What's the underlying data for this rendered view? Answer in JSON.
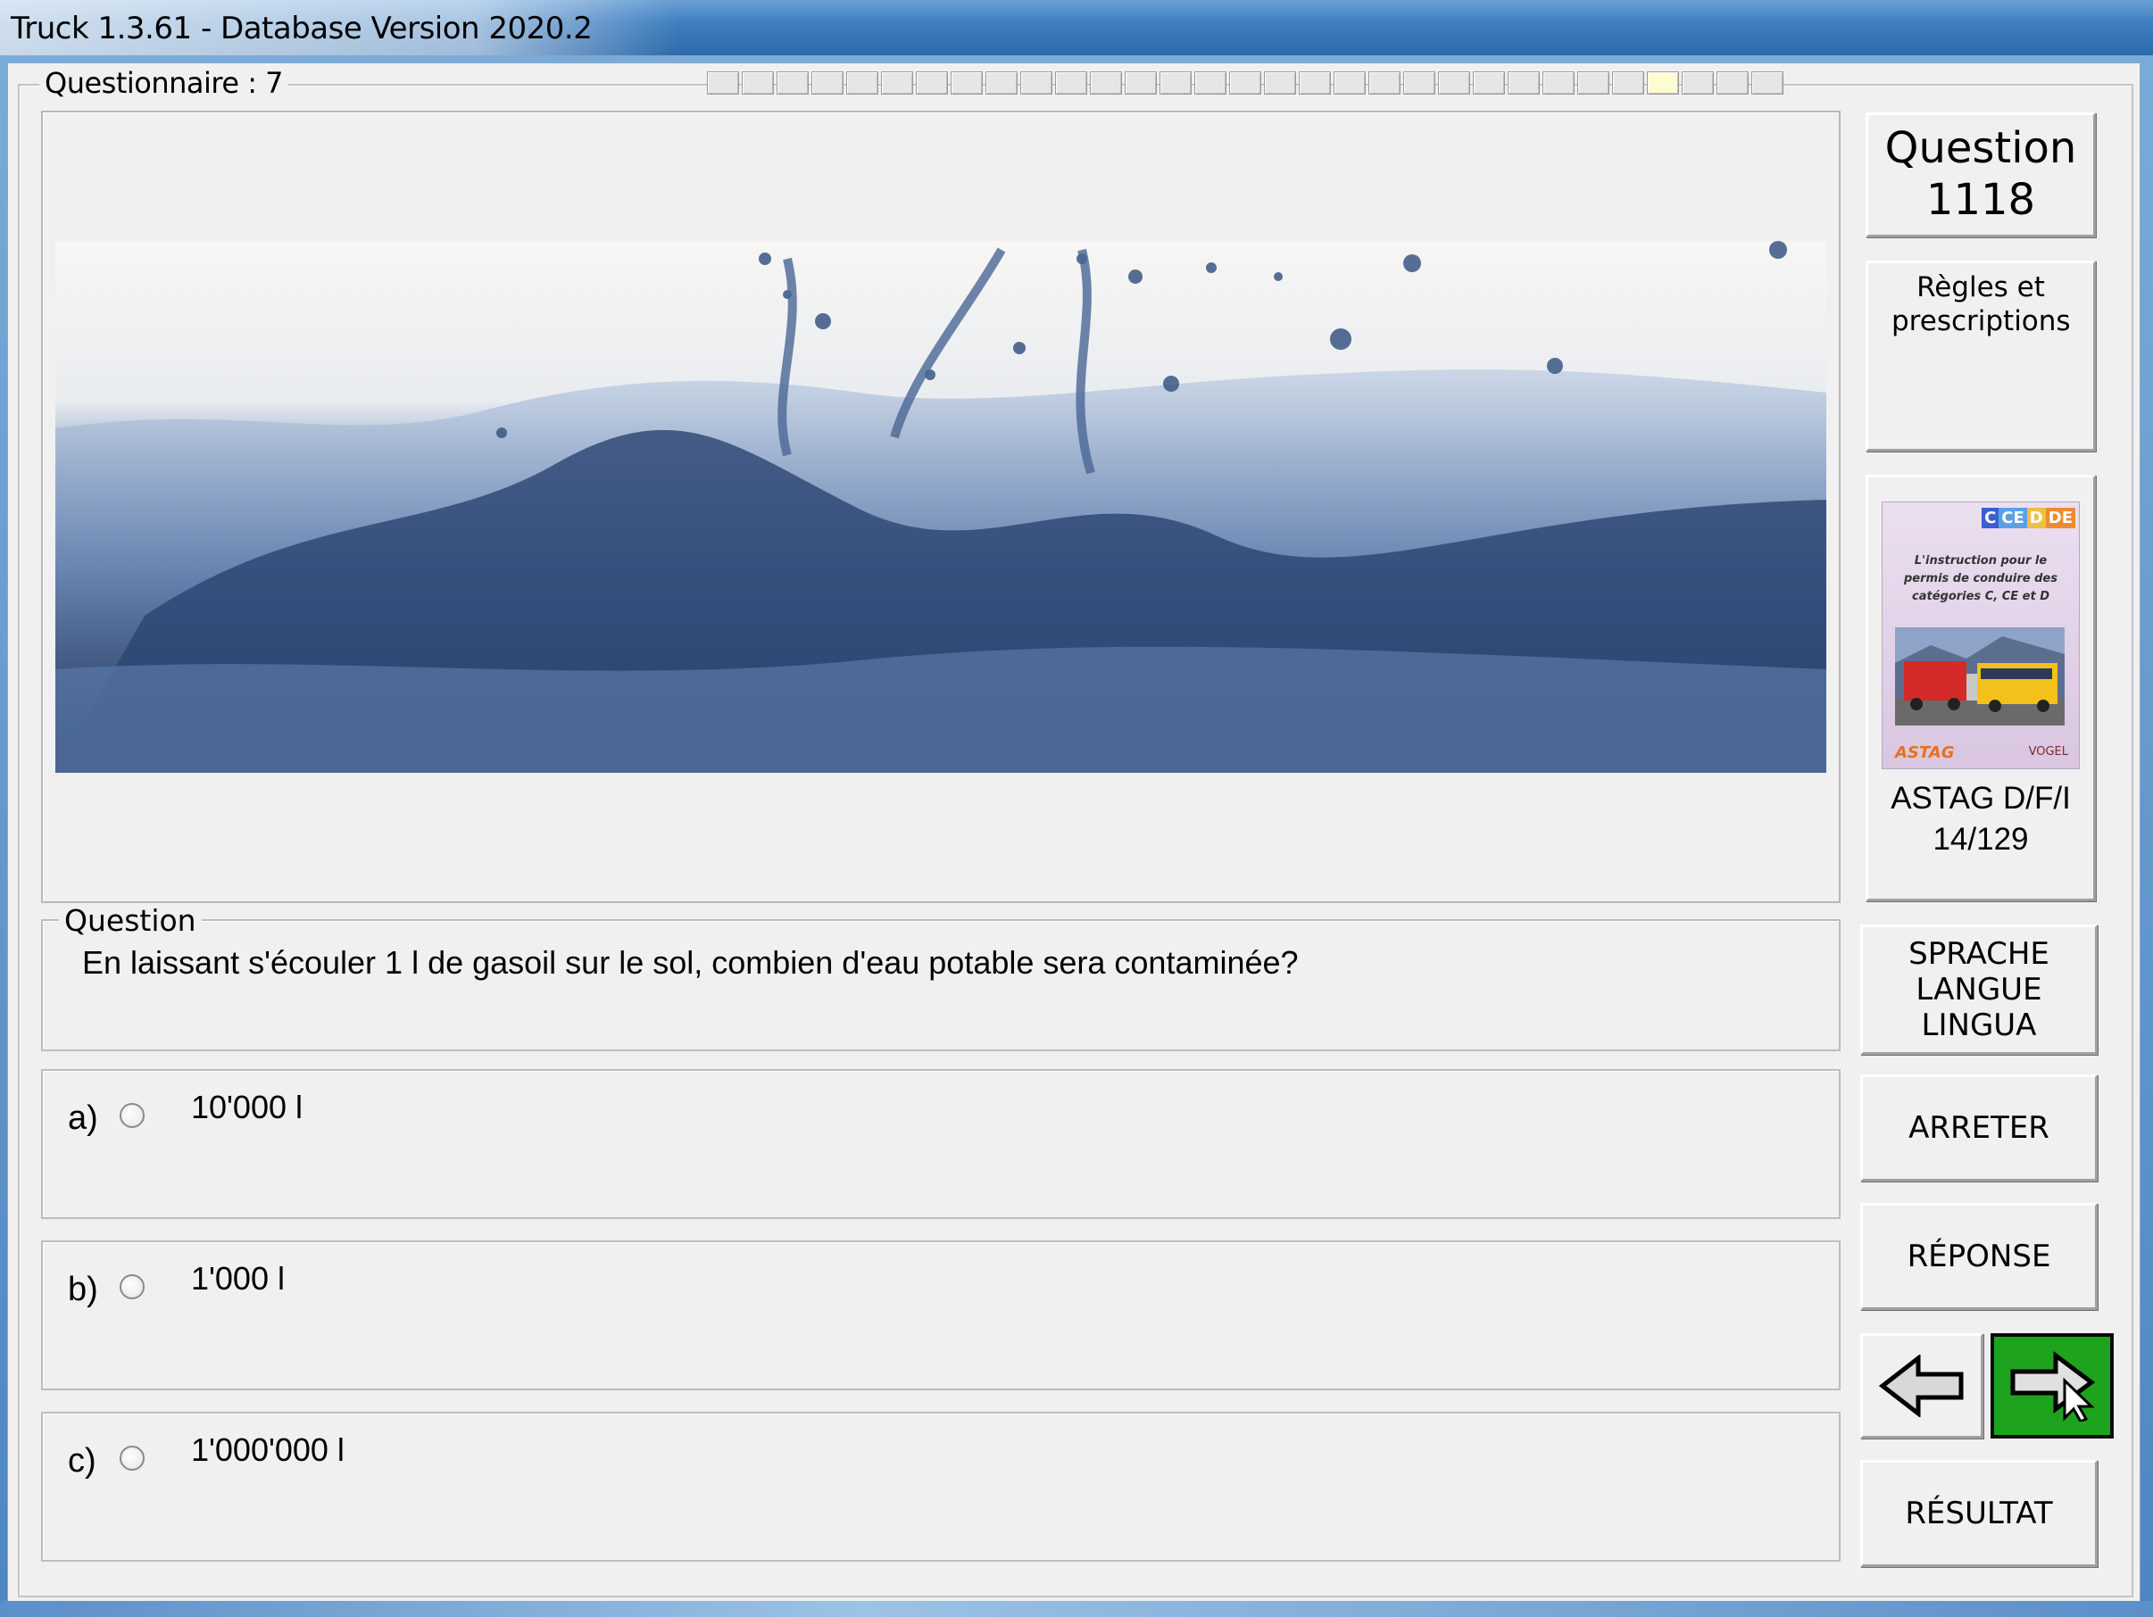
{
  "window": {
    "title": "Truck 1.3.61 - Database Version 2020.2"
  },
  "questionnaire": {
    "label": "Questionnaire : 7",
    "progress": {
      "total": 31,
      "current": 28
    }
  },
  "question": {
    "number_label": "Question",
    "number": "1118",
    "section_label": "Question",
    "text": "En laissant s'écouler 1 l de gasoil sur le sol, combien d'eau potable sera contaminée?",
    "category": "Règles et prescriptions"
  },
  "answers": [
    {
      "letter": "a)",
      "text": "10'000 l",
      "selected": false
    },
    {
      "letter": "b)",
      "text": "1'000 l",
      "selected": false
    },
    {
      "letter": "c)",
      "text": "1'000'000 l",
      "selected": false
    }
  ],
  "book": {
    "cover_tags": [
      "C",
      "CE",
      "D",
      "DE"
    ],
    "cover_text": "L'instruction pour le permis de conduire des catégories C, CE et D",
    "cover_logo": "ASTAG",
    "cover_publisher": "VOGEL",
    "caption_line1": "ASTAG D/F/I",
    "caption_line2": "14/129"
  },
  "buttons": {
    "language": [
      "SPRACHE",
      "LANGUE",
      "LINGUA"
    ],
    "stop": "ARRETER",
    "answer": "RÉPONSE",
    "result": "RÉSULTAT"
  },
  "colors": {
    "next_button": "#1ea31e",
    "tag_c": "#3a5fd0",
    "tag_ce": "#5aa0e8",
    "tag_d": "#f0c040",
    "tag_de": "#f08a30"
  }
}
